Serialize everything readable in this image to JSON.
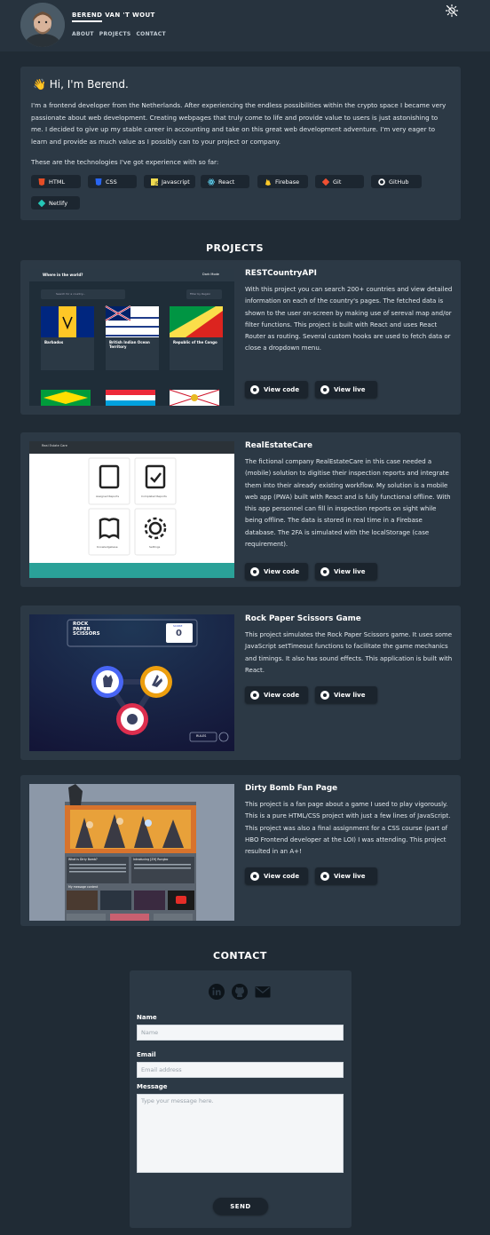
{
  "header": {
    "name": "BEREND VAN 'T WOUT",
    "nav": [
      "ABOUT",
      "PROJECTS",
      "CONTACT"
    ]
  },
  "intro": {
    "title": "👋 Hi, I'm Berend.",
    "bio": "I'm a frontend developer from the Netherlands. After experiencing the endless possibilities within the crypto space I became very passionate about web development. Creating webpages that truly come to life and provide value to users is just astonishing to me. I decided to give up my stable career in accounting and take on this great web development adventure. I'm very eager to learn and provide as much value as I possibly can to your project or company.",
    "tech_lead": "These are the technologies I've got experience with so far:",
    "technologies": [
      "HTML",
      "CSS",
      "Javascript",
      "React",
      "Firebase",
      "Git",
      "GitHub",
      "Netlify"
    ]
  },
  "projects_heading": "PROJECTS",
  "projects": [
    {
      "title": "RESTCountryAPI",
      "description": "With this project you can search 200+ countries and view detailed information on each of the country's pages. The fetched data is shown to the user on-screen by making use of sereval map and/or filter functions. This project is built with React and uses React Router as routing. Several custom hooks are used to fetch data or close a dropdown menu.",
      "code_label": "View code",
      "live_label": "View live",
      "shot": {
        "heading": "Where in the world?",
        "mode": "Dark Mode",
        "search": "Search for a country...",
        "filter": "Filter by Region",
        "countries": [
          "Barbados",
          "British Indian Ocean Territory",
          "Republic of the Congo"
        ]
      }
    },
    {
      "title": "RealEstateCare",
      "description": "The fictional company RealEstateCare in this case needed a (mobile) solution to digitise their inspection reports and integrate them into their already existing workflow. My solution is a mobile web app (PWA) built with React and is fully functional offline. With this app personnel can fill in inspection reports on sight while being offline. The data is stored in real time in a Firebase database. The 2FA is simulated with the localStorage (case requirement).",
      "code_label": "View code",
      "live_label": "View live",
      "shot": {
        "brand": "Real Estate Care",
        "tiles": [
          "Assigned Reports",
          "Completed Reports",
          "Knowledgebase",
          "Settings"
        ]
      }
    },
    {
      "title": "Rock Paper Scissors Game",
      "description": "This project simulates the Rock Paper Scissors game. It uses some JavaScript setTimeout functions to facilitate the game mechanics and timings. It also has sound effects. This application is built with React.",
      "code_label": "View code",
      "live_label": "View live",
      "shot": {
        "logo": [
          "ROCK",
          "PAPER",
          "SCISSORS"
        ],
        "score_label": "SCORE",
        "score": "0",
        "rules": "RULES"
      }
    },
    {
      "title": "Dirty Bomb Fan Page",
      "description": "This project is a fan page about a game I used to play vigorously. This is a pure HTML/CSS project with just a few lines of JavaScript. This project was also a final assignment for a CSS course (part of HBO Frontend developer at the LOI) I was attending. This project resulted in an A+!",
      "code_label": "View code",
      "live_label": "View live",
      "shot": {
        "col1": "What is Dirty Bomb?",
        "col2": "Introducing [ZH] Rungbo",
        "section": "My message content"
      }
    }
  ],
  "contact": {
    "heading": "CONTACT",
    "name_label": "Name",
    "name_placeholder": "Name",
    "email_label": "Email",
    "email_placeholder": "Email address",
    "message_label": "Message",
    "message_placeholder": "Type your message here.",
    "send_label": "SEND"
  },
  "colors": {
    "background": "#202b35",
    "card": "#2c3945",
    "button": "#1b242d"
  }
}
